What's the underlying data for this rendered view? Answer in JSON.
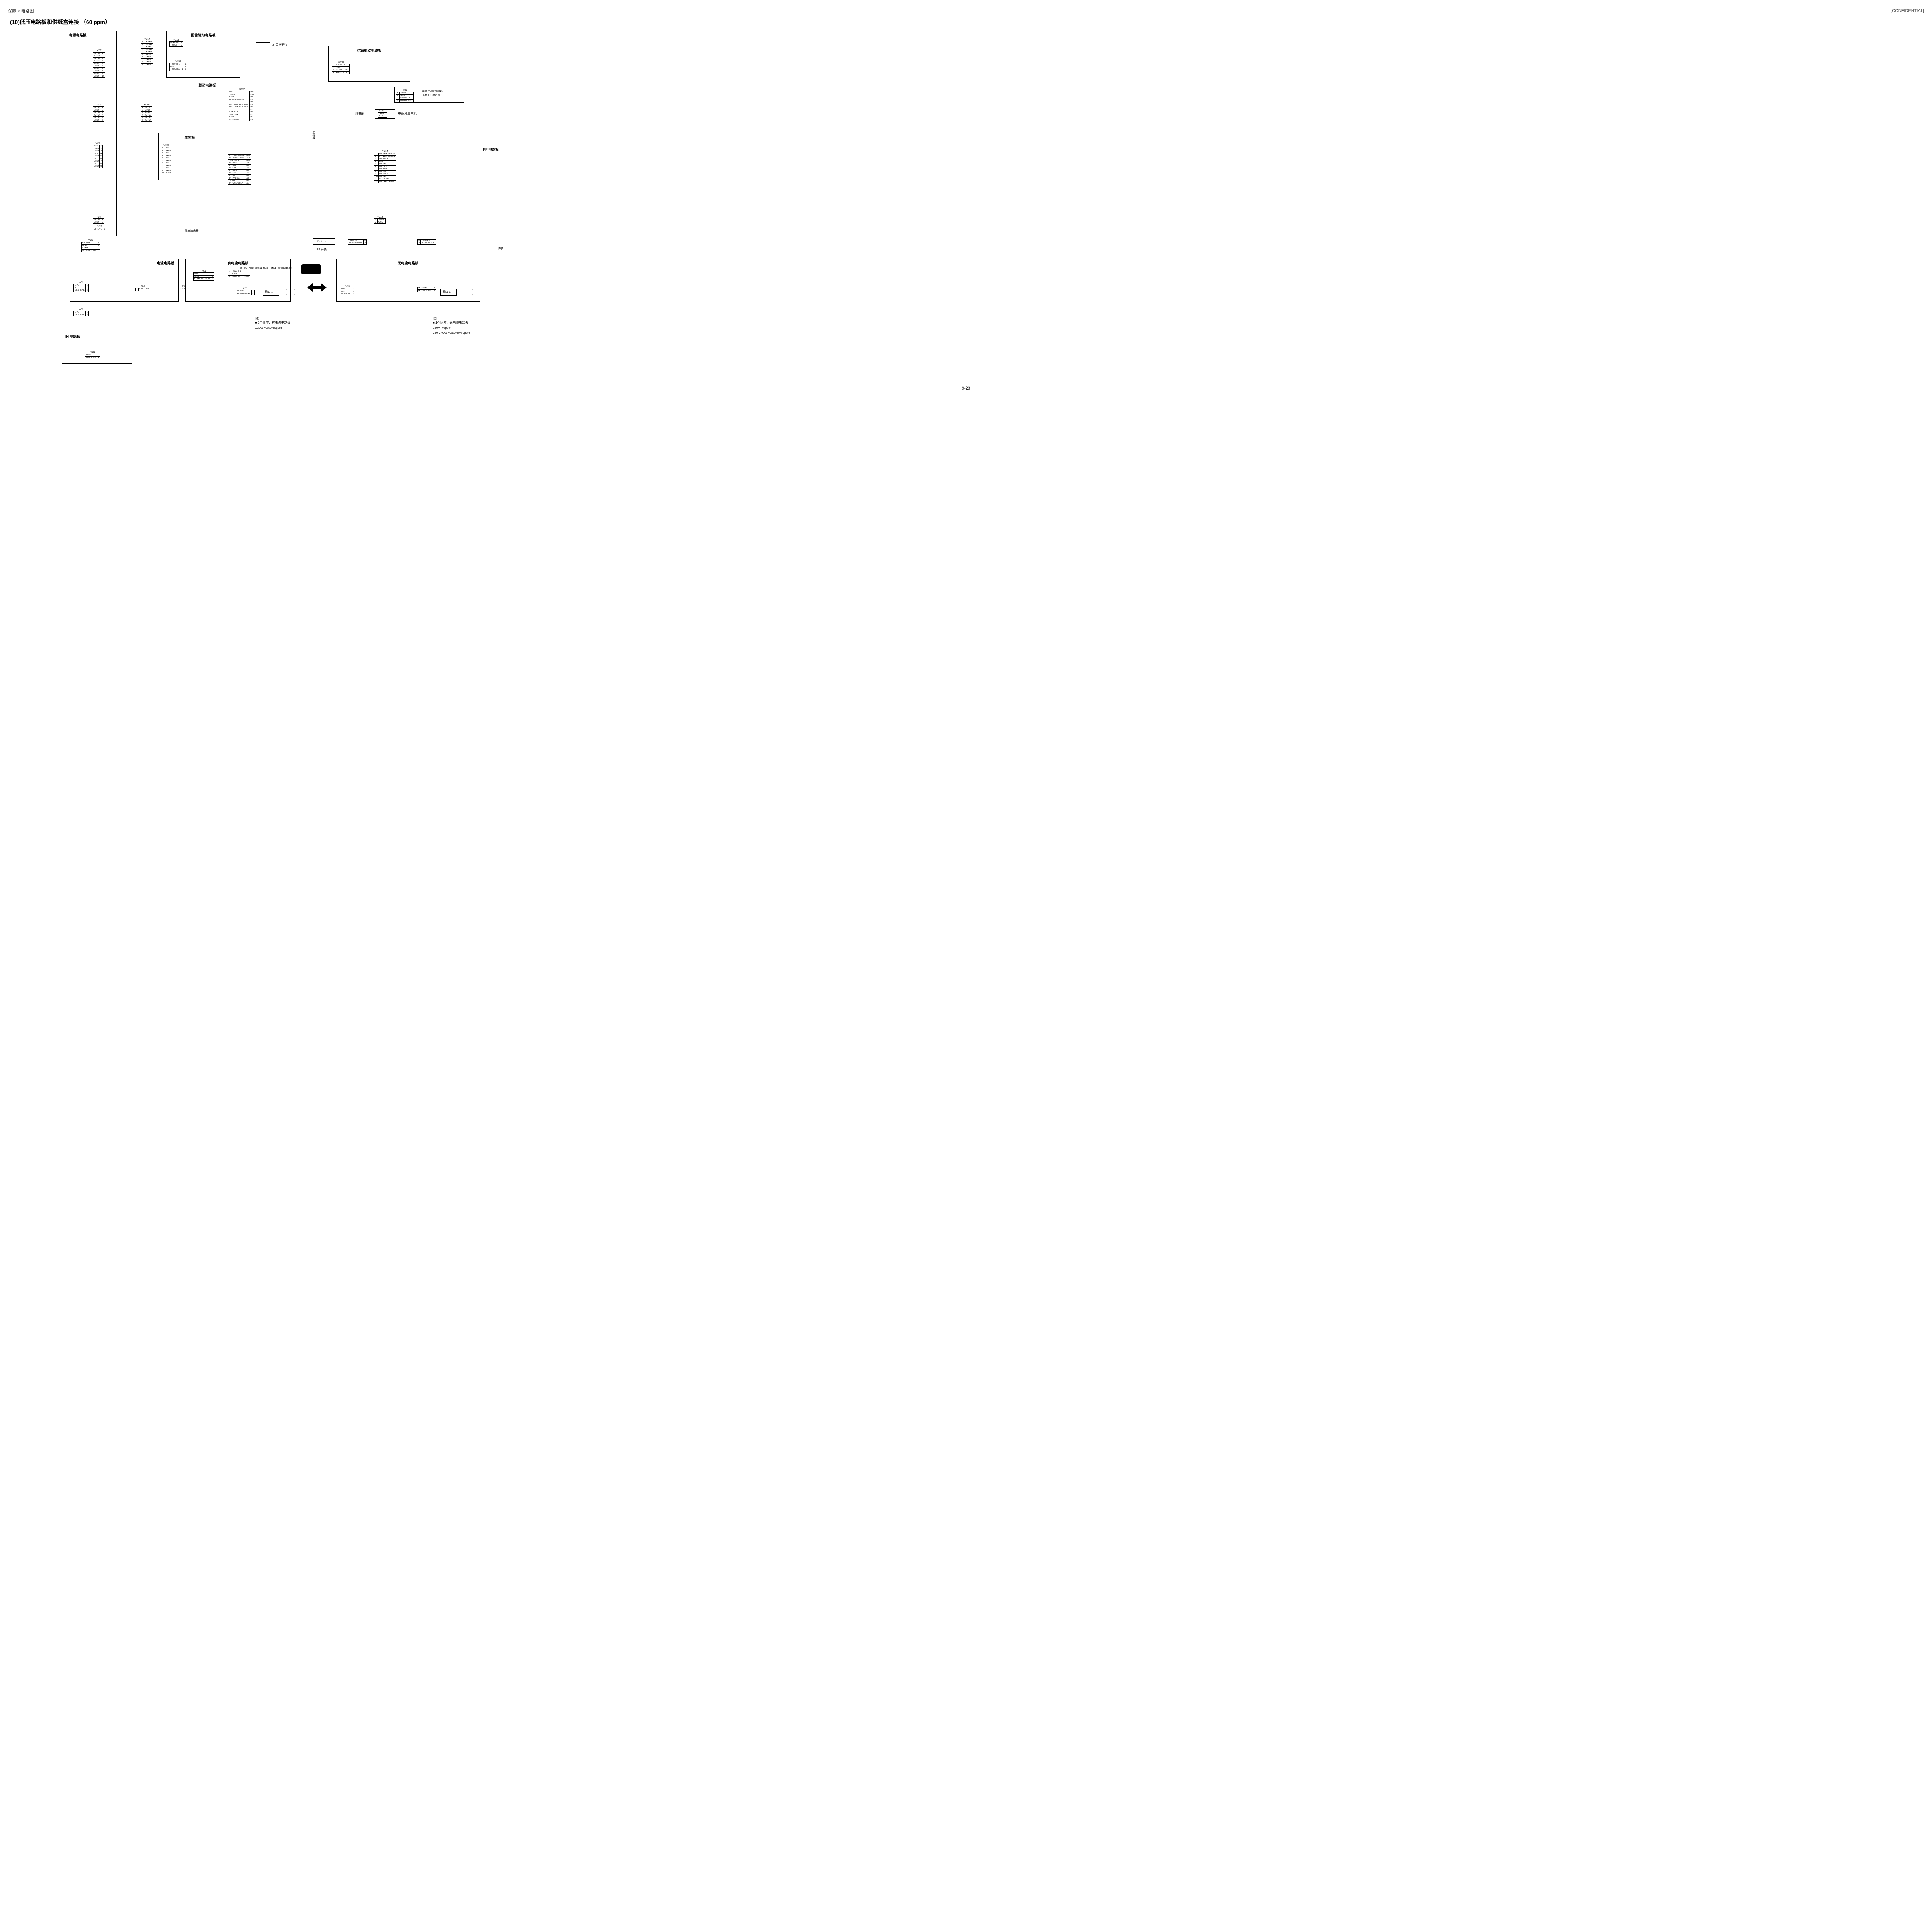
{
  "header": {
    "breadcrumb": "保养 > 电路图",
    "confidential": "[CONFIDENTIAL]"
  },
  "title": "(10)低压电路板和供纸盒连接 （60 ppm）",
  "boards": {
    "power": "电源电路板",
    "imgdrv": "图像驱动电路板",
    "feeddrv": "供纸驱动电路板",
    "drv": "驱动电路板",
    "main": "主控板",
    "temphum": "温度 / 湿度传感器\n（用于机器外部）",
    "psfan": "电源风扇电机",
    "pf": "PF 电路板",
    "cassette": "纸盒加热器",
    "current": "电流电路板",
    "withcurrent": "有电流电路板",
    "nocurrent": "无电流电路板",
    "ih": "IH 电路板",
    "relay": "继电器",
    "pflabel": "PF"
  },
  "switches": {
    "rcover": "右盖板开关",
    "pfsw": "PF 开关"
  },
  "connectors": {
    "yc7": {
      "name": "YC7",
      "rows": [
        [
          "+24V3",
          "1"
        ],
        [
          "+24V3",
          "2"
        ],
        [
          "+24V2",
          "3"
        ],
        [
          "+24V2",
          "4"
        ],
        [
          "GND",
          "5"
        ],
        [
          "GND",
          "6"
        ],
        [
          "GND",
          "7"
        ],
        [
          "GND",
          "8"
        ],
        [
          "GND",
          "9"
        ],
        [
          "GND",
          "10"
        ]
      ]
    },
    "yc14": {
      "name": "YC14",
      "rows": [
        [
          "1",
          "+24V4"
        ],
        [
          "2",
          "+24V3"
        ],
        [
          "3",
          "+24V3"
        ],
        [
          "4",
          "+24V2"
        ],
        [
          "5",
          "+24V2"
        ],
        [
          "6",
          "GND"
        ],
        [
          "7",
          "GND"
        ],
        [
          "8",
          "GND"
        ],
        [
          "9",
          "GND"
        ],
        [
          "10",
          "GND"
        ]
      ]
    },
    "yc15": {
      "name": "YC15",
      "rows": [
        [
          "+24V3 IL",
          "1"
        ],
        [
          "+24V3",
          "2"
        ]
      ]
    },
    "yc17": {
      "name": "YC17",
      "rows": [
        [
          "+24V4 F1",
          "1"
        ],
        [
          "GND",
          "2"
        ],
        [
          "+24V3 IL2 F1",
          "3"
        ]
      ]
    },
    "yc10": {
      "name": "YC10",
      "rows": [
        [
          "1",
          "+24V4 F1"
        ],
        [
          "2",
          "GND"
        ],
        [
          "3",
          "ISOMG OUT"
        ],
        [
          "4",
          "+24V3 IL2 F1"
        ]
      ]
    },
    "yc8": {
      "name": "YC8",
      "rows": [
        [
          "+24V4",
          "1"
        ],
        [
          "GND",
          "2"
        ],
        [
          "+24V3",
          "3"
        ],
        [
          "+24V4",
          "4"
        ],
        [
          "+24V4",
          "5"
        ],
        [
          "GND",
          "6"
        ]
      ]
    },
    "yc16": {
      "name": "YC16",
      "rows": [
        [
          "1",
          "+5V2"
        ],
        [
          "2",
          "GND"
        ],
        [
          "3",
          "GND"
        ],
        [
          "4",
          "+24V2"
        ],
        [
          "5",
          "+24V4"
        ],
        [
          "6",
          "+24V4"
        ]
      ]
    },
    "yc9": {
      "name": "YC9",
      "rows": [
        [
          "5V3",
          "1"
        ],
        [
          "GND",
          "2"
        ],
        [
          "GND",
          "3"
        ],
        [
          "5V3",
          "4"
        ],
        [
          "GND",
          "5"
        ],
        [
          "5V2",
          "6"
        ],
        [
          "GND",
          "7"
        ],
        [
          "5V2",
          "8"
        ],
        [
          "GND",
          "9"
        ]
      ]
    },
    "yc29": {
      "name": "YC29",
      "rows": [
        [
          "1",
          "5V"
        ],
        [
          "2",
          "GND"
        ],
        [
          "3",
          "5V"
        ],
        [
          "4",
          "GND"
        ],
        [
          "5",
          "5V"
        ],
        [
          "6",
          "GND"
        ],
        [
          "7",
          "5V"
        ],
        [
          "8",
          "GND"
        ],
        [
          "9",
          "5V"
        ],
        [
          "10",
          "GND"
        ],
        [
          "11",
          "GND"
        ]
      ]
    },
    "yc12a": {
      "name": "YC12",
      "rows": [
        [
          "N.C.",
          "B12"
        ],
        [
          "TEMP",
          "B11"
        ],
        [
          "GND",
          "B10"
        ],
        [
          "HUMTEMP CLK",
          "B9"
        ],
        [
          "",
          "B8"
        ],
        [
          "LVU PWB FAN REM",
          "B7"
        ],
        [
          "LVU PWB FAN ALM",
          "B6"
        ],
        [
          "",
          "B5"
        ],
        [
          "SUB CLK",
          "B4"
        ],
        [
          "SUB SDA",
          "B3"
        ],
        [
          "GND",
          "B2"
        ],
        [
          "+3.3V2 F1",
          "B1"
        ]
      ]
    },
    "yc12b": {
      "name": "",
      "rows": [
        [
          "PF VER SENS2",
          "A12"
        ],
        [
          "PF VER SENS1",
          "A11"
        ],
        [
          "+3.3V2 F1",
          "A10"
        ],
        [
          "PF RDY",
          "A9"
        ],
        [
          "PF SEL",
          "A8"
        ],
        [
          "PF CLK",
          "A7"
        ],
        [
          "PF SDO",
          "A6"
        ],
        [
          "PF SDI",
          "A5"
        ],
        [
          "PF SET",
          "A4"
        ],
        [
          "PF PAUSE",
          "A3"
        ],
        [
          "+24V2",
          "A2"
        ],
        [
          "PF CAS OPEN",
          "A1"
        ]
      ]
    },
    "yc1temp": {
      "name": "YC1",
      "rows": [
        [
          "4",
          "TEMP"
        ],
        [
          "3",
          "GND"
        ],
        [
          "2",
          "ISOMG OUT"
        ],
        [
          "1",
          "HUMID CLK"
        ]
      ]
    },
    "yc14pf": {
      "name": "YC14",
      "rows": [
        [
          "1",
          "PF VER SENS2"
        ],
        [
          "2",
          "PF VER SENS1"
        ],
        [
          "3",
          "+3.3V2 F1"
        ],
        [
          "4",
          "GND"
        ],
        [
          "5",
          "PF SEL"
        ],
        [
          "6",
          "PF CLK"
        ],
        [
          "7",
          "PF RDY"
        ],
        [
          "8",
          "PF SDI"
        ],
        [
          "9",
          "PF SDO"
        ],
        [
          "10",
          "PF SET"
        ],
        [
          "11",
          "PF PAUSE"
        ],
        [
          "12",
          "PF CAS OPEN"
        ]
      ]
    },
    "yc6": {
      "name": "YC6",
      "rows": [
        [
          "+24V2",
          "1"
        ],
        [
          "GND",
          "2"
        ]
      ]
    },
    "yc13": {
      "name": "YC13",
      "rows": [
        [
          "1",
          "+24V2"
        ],
        [
          "2",
          "GND"
        ]
      ]
    },
    "yc5": {
      "name": "YC5",
      "rows": [
        [
          "CH LIVE",
          "1"
        ]
      ]
    },
    "yc1pwr": {
      "name": "YC1",
      "rows": [
        [
          "CH LIVE",
          "1"
        ],
        [
          "N.C.",
          "2"
        ],
        [
          "+24V4",
          "3"
        ],
        [
          "CH NEUTRAL",
          "4"
        ]
      ]
    },
    "yc1curr": {
      "name": "YC1",
      "rows": [
        [
          "LIVE",
          "1"
        ],
        [
          "N.C.",
          "2"
        ],
        [
          "NEUTRAL",
          "3"
        ]
      ]
    },
    "yc3": {
      "name": "YC3",
      "rows": [
        [
          "LIVE",
          "1"
        ],
        [
          "NEUTRAL",
          "2"
        ]
      ]
    },
    "yc1ih": {
      "name": "YC1",
      "rows": [
        [
          "LIVE",
          "1"
        ],
        [
          "NEUTRAL",
          "2"
        ]
      ]
    },
    "tb2": {
      "name": "TB2",
      "rows": [
        [
          "1",
          "LIVE OUT"
        ]
      ]
    },
    "tb1": {
      "name": "TB1",
      "rows": [
        [
          "LIVE IN",
          "1"
        ]
      ]
    },
    "yc1wc": {
      "name": "YC1",
      "rows": [
        [
          "+5V2",
          "1"
        ],
        [
          "GND",
          "2"
        ],
        [
          "CURRENT MON",
          "3"
        ]
      ]
    },
    "yc1wc2": {
      "name": "",
      "rows": [
        [
          "1",
          "+5V2_F1"
        ],
        [
          "2",
          "GND"
        ],
        [
          "3",
          "CURRENT_MON"
        ]
      ]
    },
    "yc1wc3": {
      "name": "YC1",
      "rows": [
        [
          "AC LIVE",
          "1"
        ],
        [
          "AC NEUTRAL",
          "2"
        ]
      ]
    },
    "yc1nc": {
      "name": "YC1",
      "rows": [
        [
          "LIVE",
          "1"
        ],
        [
          "N.C.",
          "2"
        ],
        [
          "NEUTRAL",
          "3"
        ]
      ]
    },
    "yc1nc2": {
      "name": "",
      "rows": [
        [
          "AC LIVE",
          "1"
        ],
        [
          "AC NEUTRAL",
          "2"
        ]
      ]
    },
    "yc1pfac": {
      "name": "",
      "rows": [
        [
          "AC LIVE",
          "1"
        ],
        [
          "AC NEUTRAL",
          "2"
        ]
      ]
    },
    "pfac": {
      "name": "",
      "rows": [
        [
          "1",
          "AC LIVE"
        ],
        [
          "2",
          "AC NEUTRAL"
        ]
      ]
    },
    "fan": {
      "name": "",
      "rows": [
        [
          "+24V",
          ""
        ],
        [
          "GND",
          ""
        ],
        [
          "ALM",
          ""
        ]
      ]
    }
  },
  "misc": {
    "relaytext": "至（6）供纸驱动电路板）（供纸驱动电路板）",
    "socket": "插口 1",
    "mainlabel": "主控板",
    "relaylabel": "继电器"
  },
  "notes": {
    "left": {
      "hdr": "[注]",
      "l1": "■ 1个插座，有电流电路板",
      "l2": "120V: 40/50/60ppm"
    },
    "right": {
      "hdr": "[注]",
      "l1": "■ 1个插座，无电流电路板",
      "l2": "120V: 70ppm",
      "l3": "220-240V: 40/50/60/70ppm"
    }
  },
  "footer": "9-23"
}
